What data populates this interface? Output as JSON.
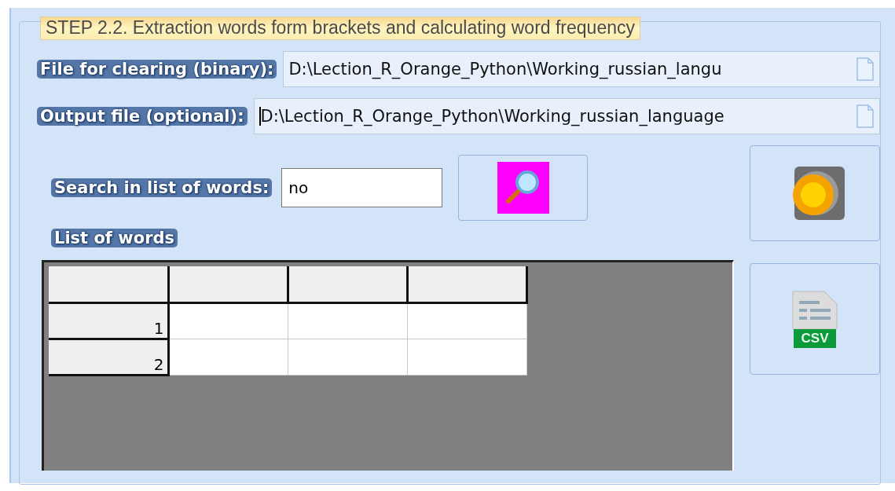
{
  "group": {
    "title": "STEP 2.2. Extraction words form brackets and calculating word frequency"
  },
  "fields": [
    {
      "label": "File for clearing (binary):",
      "value": "D:\\Lection_R_Orange_Python\\Working_russian_langu",
      "focused": false
    },
    {
      "label": "Output file (optional):",
      "value": "D:\\Lection_R_Orange_Python\\Working_russian_language",
      "focused": true
    }
  ],
  "search": {
    "label": "Search in list of words:",
    "value": "no"
  },
  "list": {
    "label": "List of words",
    "rows": [
      {
        "header": "1"
      },
      {
        "header": "2"
      }
    ]
  },
  "csv_button": {
    "label": "CSV"
  }
}
